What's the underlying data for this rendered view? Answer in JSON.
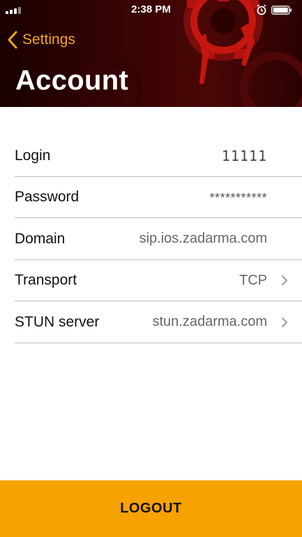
{
  "status_bar": {
    "time": "2:38 PM",
    "signal_icon": "signal-icon",
    "alarm_icon": "alarm-icon",
    "battery_icon": "battery-icon"
  },
  "nav": {
    "back_label": "Settings",
    "back_icon": "chevron-left-icon",
    "title": "Account"
  },
  "colors": {
    "accent": "#f4a620",
    "header_bg": "#3a0404",
    "logout_bg": "#f6a200"
  },
  "account": {
    "rows": [
      {
        "label": "Login",
        "value": "11111"
      },
      {
        "label": "Password",
        "value": "***********"
      },
      {
        "label": "Domain",
        "value": "sip.ios.zadarma.com"
      },
      {
        "label": "Transport",
        "value": "TCP"
      },
      {
        "label": "STUN server",
        "value": "stun.zadarma.com"
      }
    ]
  },
  "logout_label": "LOGOUT"
}
